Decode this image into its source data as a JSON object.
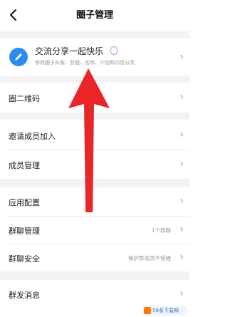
{
  "header": {
    "title": "圈子管理",
    "back_icon": "back-arrow-icon"
  },
  "profile": {
    "name": "交流分享一起快乐",
    "badge": "",
    "description": "修改圈子头像、封面、名称、介绍和内容分类",
    "avatar_icon": "pencil-icon",
    "avatar_color": "#2b8cf0"
  },
  "menu": {
    "qr_code": "圈二维码",
    "invite_members": "邀请成员加入",
    "member_management": "成员管理",
    "app_settings": "应用配置",
    "group_chat_management": "群聊管理",
    "group_chat_management_value": "1个群聊",
    "group_chat_security": "群聊安全",
    "group_chat_security_value": "保护群成员不受骚",
    "broadcast_message": "群发消息"
  },
  "annotation": {
    "arrow_color": "#e8262a"
  },
  "watermark": {
    "text": "59系下载网"
  }
}
